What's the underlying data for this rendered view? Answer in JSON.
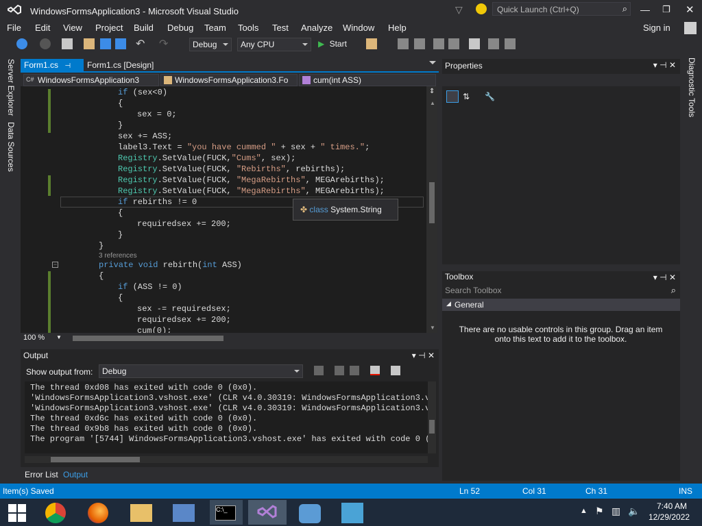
{
  "titlebar": {
    "title": "WindowsFormsApplication3 - Microsoft Visual Studio",
    "quick_launch_placeholder": "Quick Launch (Ctrl+Q)"
  },
  "menu": [
    "File",
    "Edit",
    "View",
    "Project",
    "Build",
    "Debug",
    "Team",
    "Tools",
    "Test",
    "Analyze",
    "Window",
    "Help"
  ],
  "sign_in": "Sign in",
  "toolbar": {
    "config": "Debug",
    "platform": "Any CPU",
    "start": "Start"
  },
  "left_strip": [
    "Server Explorer",
    "Data Sources"
  ],
  "right_strip": [
    "Diagnostic Tools"
  ],
  "editor": {
    "tabs": [
      {
        "label": "Form1.cs",
        "active": true
      },
      {
        "label": "Form1.cs [Design]",
        "active": false
      }
    ],
    "nav": {
      "project": "WindowsFormsApplication3",
      "class": "WindowsFormsApplication3.Fo",
      "member": "cum(int ASS)"
    },
    "zoom": "100 %",
    "references": "3 references",
    "tooltip": {
      "keyword": "class",
      "type": "System.String"
    }
  },
  "output": {
    "title": "Output",
    "show_from_label": "Show output from:",
    "source": "Debug",
    "lines": [
      "The thread 0xd08 has exited with code 0 (0x0).",
      "'WindowsFormsApplication3.vshost.exe' (CLR v4.0.30319: WindowsFormsApplication3.vsh",
      "'WindowsFormsApplication3.vshost.exe' (CLR v4.0.30319: WindowsFormsApplication3.vsh",
      "The thread 0xd6c has exited with code 0 (0x0).",
      "The thread 0x9b8 has exited with code 0 (0x0).",
      "The program '[5744] WindowsFormsApplication3.vshost.exe' has exited with code 0 (0x"
    ],
    "tabs": [
      "Error List",
      "Output"
    ]
  },
  "properties": {
    "title": "Properties"
  },
  "toolbox": {
    "title": "Toolbox",
    "search_placeholder": "Search Toolbox",
    "group": "General",
    "empty_message": "There are no usable controls in this group. Drag an item onto this text to add it to the toolbox."
  },
  "status": {
    "message": "Item(s) Saved",
    "ln": "Ln 52",
    "col": "Col 31",
    "ch": "Ch 31",
    "mode": "INS"
  },
  "clock": {
    "time": "7:40 AM",
    "date": "12/29/2022"
  },
  "colors": {
    "accent": "#007acc",
    "vs_purple": "#68217a"
  }
}
